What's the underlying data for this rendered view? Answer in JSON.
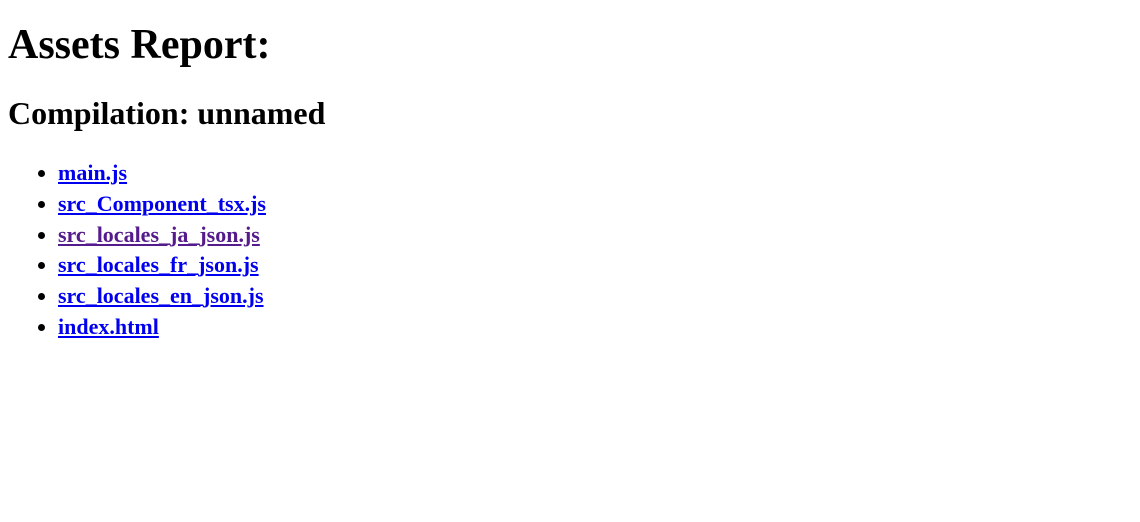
{
  "heading": "Assets Report:",
  "subheading": "Compilation: unnamed",
  "assets": [
    {
      "label": "main.js",
      "visited": false
    },
    {
      "label": "src_Component_tsx.js",
      "visited": false
    },
    {
      "label": "src_locales_ja_json.js",
      "visited": true
    },
    {
      "label": "src_locales_fr_json.js",
      "visited": false
    },
    {
      "label": "src_locales_en_json.js",
      "visited": false
    },
    {
      "label": "index.html",
      "visited": false
    }
  ]
}
